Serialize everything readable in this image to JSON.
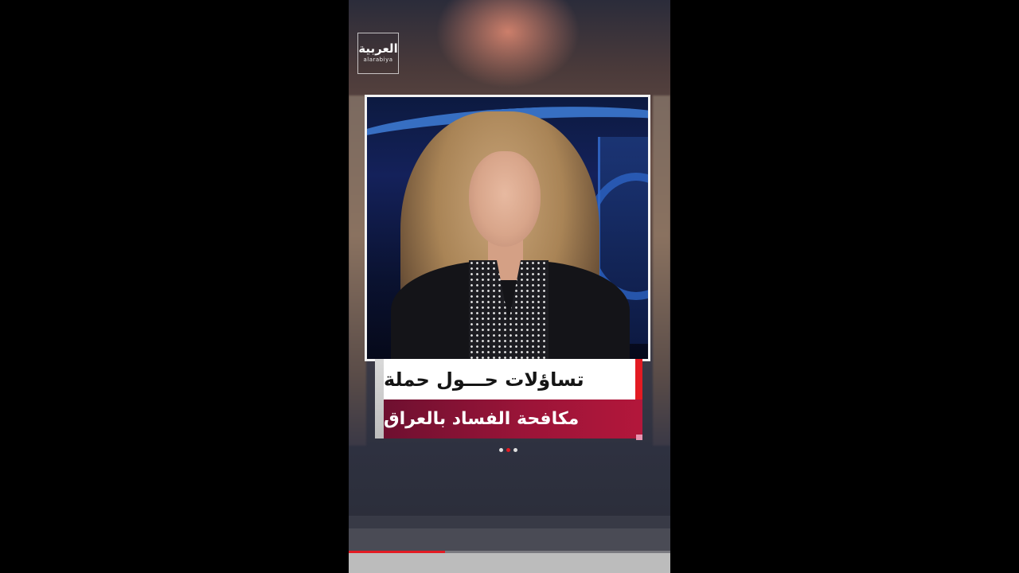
{
  "logo": {
    "arabic": "العربية",
    "latin": "alarabiya"
  },
  "headline": {
    "line1": "تساؤلات حـــول حملة",
    "line2": "مكافحة الفساد بالعراق"
  },
  "pager": {
    "count": 3,
    "active_index": 1
  },
  "playback": {
    "progress_fraction": 0.3
  },
  "colors": {
    "accent_red": "#e31b23",
    "headline_red": "#9b1438",
    "headline_white": "#ffffff"
  }
}
